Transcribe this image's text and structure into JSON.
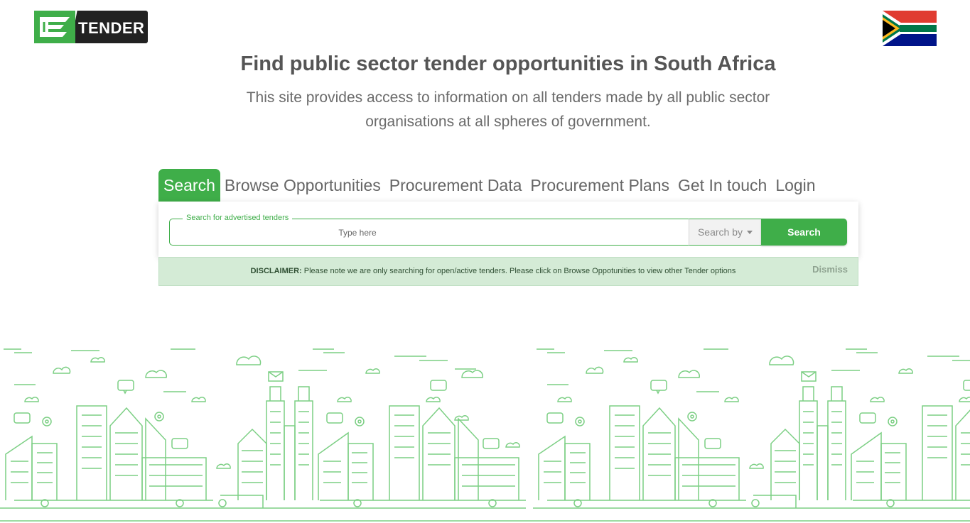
{
  "brand": {
    "logo_text": "TENDER",
    "primary_color": "#3fae49",
    "dark_color": "#222222"
  },
  "flag": {
    "icon": "south-africa-flag"
  },
  "hero": {
    "title": "Find public sector tender opportunities in South Africa",
    "subtitle": "This site provides access to information on all tenders made by all public sector organisations at all spheres of government."
  },
  "nav": {
    "tabs": [
      {
        "label": "Search",
        "active": true
      },
      {
        "label": "Browse Opportunities",
        "active": false
      },
      {
        "label": "Procurement Data",
        "active": false
      },
      {
        "label": "Procurement Plans",
        "active": false
      },
      {
        "label": "Get In touch",
        "active": false
      },
      {
        "label": "Login",
        "active": false
      }
    ]
  },
  "search": {
    "legend": "Search for advertised tenders",
    "placeholder": "Type here",
    "value": "",
    "search_by_label": "Search by",
    "button_label": "Search"
  },
  "disclaimer": {
    "label": "DISCLAIMER:",
    "text": " Please note we are only searching for open/active tenders. Please click on Browse Oppotunities to view other Tender options",
    "dismiss_label": "Dismiss"
  },
  "illustration": {
    "icon": "city-skyline-illustration",
    "color": "#7ccf84"
  }
}
